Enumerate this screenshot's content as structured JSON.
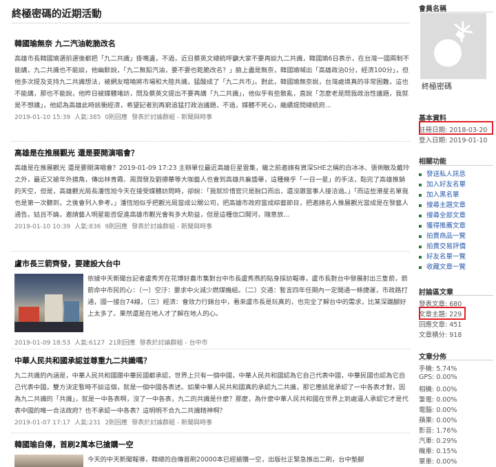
{
  "page": {
    "title": "終極密碼的近期活動"
  },
  "posts": [
    {
      "title": "韓國瑜無奈 九二汽油乾脆改名",
      "body": "高雄市長韓國瑜選前選後都把「九二共識」掛嘴邊，不過，近日蔡英文總統呼籲大家不要再談九二共識，韓國瑜6日表示，在台灣一國兩制不能講，九二共識也不能談，他幽默說，「九二無鉛汽油，要不要也乾脆改名？」臉上盡是無奈，韓國瑜喊出「高雄政治0分，經濟100分」，但他多次提及支持九二共識想法，被網友暗喻將市場和大陸共識，猛酸成了「九二共市」。對此，韓國瑜無奈說，台灣處境真的非常困難，這也不能講，那也不能說，他昨日被媒體堵訪，問及蔡英文提出不要再講「九二共識」，他似乎有些散亂，直說「怎麼老是問我政治性議題，我就是不想講」，他認為高雄此時該衝經濟，希望記者別再窮追猛打政治議題，不過，媒體不死心，繼續提問總統府...",
      "date": "2019-01-10 15:39",
      "views": "人氣:385",
      "replies": "0則回應",
      "source": "發表於討論群組 - 新聞與時事"
    },
    {
      "title": "高雄是在推展觀光 還是要開演唱會？",
      "body": "高雄是在推展觀光 還是要開演唱會？2019-01-09 17:23 主辦單位最近高雄巨星雲集，繼之前邀請有資深SHE之稱的白冰冰、張俐敏及戴玲之外，最近又搶年外撓角，傳出林青霞、周潤發及劉德華等大咖藝人也會到高雄共襄盛舉，這種幾乎「一日一星」的手法，黏完了高雄推銷的天空，但是，高雄觀光局長潘恆旭今天在接受媒體訪問時，卻說：「我就珍惜官只是脫口而出，還沒跟當事人接洽過。」「而這些港星名單我也是第一次聽到，之後會列入參考。」潘恆旭似乎把觀光局當成公關公司，把高雄市政府當成綜藝節目，把邀請名人推展觀光當成是在發藝人通告。姑且不論，邀請藝人明星能否促進高雄市觀光會有多大助益，但是這種信口開河，隨意放...",
      "date": "2019-01-10 10:39",
      "views": "人氣:836",
      "replies": "9則回應",
      "source": "發表於討論群組 - 新聞與時事"
    },
    {
      "title": "盧市長三箭齊發，要建設大台中",
      "body": "依據中天新聞台記者盧秀芳在花博好農市集對台中市長盧秀燕的貼身採訪報導，盧市長對台中發展射出三隻箭，箭箭命中市民的心：（一）空汙：要求中火減少燃煤機組。（二）交通：暫言四年任期內一定開通一條捷運，市政路打通，國一接台74線，（三）經濟：會效力行銷台中，看來盧市長是玩真的，也完全了解台中的需求，比某深踹腳好上太多了。果然還是在地人才了解在地人的心。",
      "date": "2019-01-09 18:53",
      "views": "人氣:6127",
      "replies": "21則回應",
      "source": "發表於討論群組 - 台中市"
    },
    {
      "title": "中華人民共和國承認並尊重九二共識嗎？",
      "body": "九二共識的內涵是，中華人民共和國跟中華民國都承認，世界上只有一個中國，中華人民共和國認為它自己代表中國，中華民國也認為它自己代表中國，雙方決定暫時不談這個，就是一個中國各表述。如果中華人民共和國真的承認九二共識，那它應該是承認了一中各表才對，因為九二共識的「共識」，就是一中各表啊，沒了一中各表，九二的共識是什麼？那麼，為什麼中華人民共和國在世界上到處逼人承認它才是代表中國的唯一合法政府？也不承認一中各表？這明明不合九二共識精神啊？",
      "date": "2019-01-07 17:17",
      "views": "人氣:231",
      "replies": "2則回應",
      "source": "發表於討論群組 - 新聞與時事"
    },
    {
      "title": "韓國瑜自傳，首刷2萬本已搶購一空",
      "body": "今天的中天新聞報導，韓總的自傳首刷20000本已經搶購一空，出版社正緊急推出二刷，台中墊腳"
    }
  ],
  "sidebar": {
    "member_heading": "會員名稱",
    "nickname": "終極密碼",
    "basic_heading": "基本資料",
    "register_date": "註冊日期: 2018-03-20",
    "last_login": "登入日期: 2019-01-10",
    "functions_heading": "相關功能",
    "functions": [
      "發送私人訊息",
      "加入好友名單",
      "加入黑名單",
      "搜尋主題文章",
      "搜尋全部文章",
      "獲得推薦文章",
      "拍賣商品一覽",
      "拍賣交易評價",
      "好友名單一覽",
      "收藏文章一覽"
    ],
    "forum_heading": "討論區文章",
    "forum_stats": [
      "發表文章: 680",
      "文章主題: 229",
      "回應文章: 451",
      "文章積分: 918"
    ],
    "dist_heading": "文章分佈",
    "distribution": [
      "手機: 5.74%",
      "GPS: 0.00%",
      "相機: 0.00%",
      "筆電: 0.00%",
      "電腦: 0.00%",
      "蘋果: 0.00%",
      "影音: 1.76%",
      "汽車: 0.29%",
      "機車: 0.15%",
      "單車: 0.00%"
    ]
  },
  "colors": {
    "highlight": "#e01b24",
    "link": "#2255aa",
    "bullet": "#2a7a3a"
  },
  "icons": {
    "avatar": "bomb-icon",
    "bullet": "square-bullet-icon"
  }
}
